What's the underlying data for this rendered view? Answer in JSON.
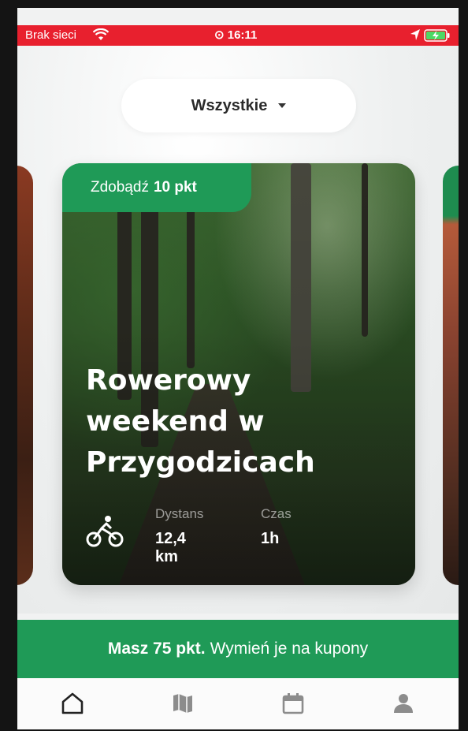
{
  "status_bar": {
    "carrier": "Brak sieci",
    "time": "16:11",
    "wifi_icon": "wifi-icon",
    "location_icon": "location-arrow-icon",
    "battery_icon": "battery-charging-icon",
    "background_color": "#e8202e"
  },
  "filter": {
    "label": "Wszystkie",
    "icon": "chevron-down-icon"
  },
  "card": {
    "badge_prefix": "Zdobądź",
    "badge_points": "10 pkt",
    "title": "Rowerowy\nweekend w\nPrzygodzicach",
    "activity_icon": "bicycle-icon",
    "distance_label": "Dystans",
    "distance_value": "12,4 km",
    "time_label": "Czas",
    "time_value": "1h"
  },
  "promo": {
    "points_text": "Masz 75 pkt.",
    "action_text": "Wymień je na kupony"
  },
  "tabbar": {
    "items": [
      {
        "icon": "home-icon",
        "active": true
      },
      {
        "icon": "map-icon",
        "active": false
      },
      {
        "icon": "calendar-icon",
        "active": false
      },
      {
        "icon": "user-icon",
        "active": false
      }
    ]
  },
  "colors": {
    "accent_green": "#1f9a57",
    "status_red": "#e8202e"
  }
}
